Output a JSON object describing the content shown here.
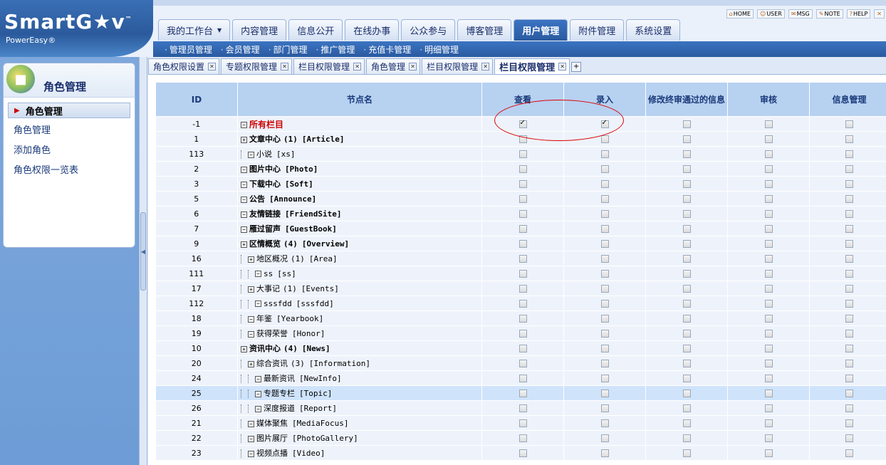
{
  "brand": {
    "logo": "SmartG★v",
    "tm": "™",
    "sub": "PowerEasy®"
  },
  "quicklinks": [
    {
      "icon": "home-icon",
      "label": "HOME"
    },
    {
      "icon": "user-icon",
      "label": "USER"
    },
    {
      "icon": "msg-icon",
      "label": "MSG"
    },
    {
      "icon": "note-icon",
      "label": "NOTE"
    },
    {
      "icon": "help-icon",
      "label": "HELP"
    },
    {
      "icon": "close-icon",
      "label": ""
    }
  ],
  "main_tabs": [
    {
      "label": "我的工作台",
      "dropdown": true
    },
    {
      "label": "内容管理"
    },
    {
      "label": "信息公开"
    },
    {
      "label": "在线办事"
    },
    {
      "label": "公众参与"
    },
    {
      "label": "博客管理"
    },
    {
      "label": "用户管理",
      "active": true
    },
    {
      "label": "附件管理"
    },
    {
      "label": "系统设置"
    }
  ],
  "sub_nav": [
    "管理员管理",
    "会员管理",
    "部门管理",
    "推广管理",
    "充值卡管理",
    "明细管理"
  ],
  "sidebar": {
    "title": "角色管理",
    "active": "角色管理",
    "items": [
      "角色管理",
      "添加角色",
      "角色权限一览表"
    ]
  },
  "doc_tabs": [
    {
      "label": "角色权限设置"
    },
    {
      "label": "专题权限管理"
    },
    {
      "label": "栏目权限管理"
    },
    {
      "label": "角色管理"
    },
    {
      "label": "栏目权限管理"
    },
    {
      "label": "栏目权限管理",
      "active": true
    }
  ],
  "table": {
    "headers": [
      "ID",
      "节点名",
      "查看",
      "录入",
      "修改终审通过的信息",
      "审核",
      "信息管理"
    ],
    "rows": [
      {
        "id": "-1",
        "name": "所有栏目",
        "code": "",
        "count": "",
        "level": 0,
        "toggle": "−",
        "red": true,
        "checks": [
          true,
          true,
          false,
          false,
          false
        ]
      },
      {
        "id": "1",
        "name": "文章中心",
        "count": "(1)",
        "code": "[Article]",
        "level": 0,
        "toggle": "+",
        "checks": [
          false,
          false,
          false,
          false,
          false
        ]
      },
      {
        "id": "113",
        "name": "小说",
        "count": "",
        "code": "[xs]",
        "level": 1,
        "toggle": "−",
        "checks": [
          false,
          false,
          false,
          false,
          false
        ]
      },
      {
        "id": "2",
        "name": "图片中心",
        "count": "",
        "code": "[Photo]",
        "level": 0,
        "toggle": "−",
        "checks": [
          false,
          false,
          false,
          false,
          false
        ]
      },
      {
        "id": "3",
        "name": "下载中心",
        "count": "",
        "code": "[Soft]",
        "level": 0,
        "toggle": "−",
        "checks": [
          false,
          false,
          false,
          false,
          false
        ]
      },
      {
        "id": "5",
        "name": "公告",
        "count": "",
        "code": "[Announce]",
        "level": 0,
        "toggle": "−",
        "checks": [
          false,
          false,
          false,
          false,
          false
        ]
      },
      {
        "id": "6",
        "name": "友情链接",
        "count": "",
        "code": "[FriendSite]",
        "level": 0,
        "toggle": "−",
        "checks": [
          false,
          false,
          false,
          false,
          false
        ]
      },
      {
        "id": "7",
        "name": "雁过留声",
        "count": "",
        "code": "[GuestBook]",
        "level": 0,
        "toggle": "−",
        "checks": [
          false,
          false,
          false,
          false,
          false
        ]
      },
      {
        "id": "9",
        "name": "区情概览",
        "count": "(4)",
        "code": "[Overview]",
        "level": 0,
        "toggle": "+",
        "checks": [
          false,
          false,
          false,
          false,
          false
        ]
      },
      {
        "id": "16",
        "name": "地区概况",
        "count": "(1)",
        "code": "[Area]",
        "level": 1,
        "toggle": "+",
        "checks": [
          false,
          false,
          false,
          false,
          false
        ]
      },
      {
        "id": "111",
        "name": "ss",
        "count": "",
        "code": "[ss]",
        "level": 2,
        "toggle": "−",
        "checks": [
          false,
          false,
          false,
          false,
          false
        ]
      },
      {
        "id": "17",
        "name": "大事记",
        "count": "(1)",
        "code": "[Events]",
        "level": 1,
        "toggle": "+",
        "checks": [
          false,
          false,
          false,
          false,
          false
        ]
      },
      {
        "id": "112",
        "name": "sssfdd",
        "count": "",
        "code": "[sssfdd]",
        "level": 2,
        "toggle": "−",
        "checks": [
          false,
          false,
          false,
          false,
          false
        ]
      },
      {
        "id": "18",
        "name": "年鉴",
        "count": "",
        "code": "[Yearbook]",
        "level": 1,
        "toggle": "−",
        "checks": [
          false,
          false,
          false,
          false,
          false
        ]
      },
      {
        "id": "19",
        "name": "获得荣誉",
        "count": "",
        "code": "[Honor]",
        "level": 1,
        "toggle": "−",
        "checks": [
          false,
          false,
          false,
          false,
          false
        ]
      },
      {
        "id": "10",
        "name": "资讯中心",
        "count": "(4)",
        "code": "[News]",
        "level": 0,
        "toggle": "+",
        "checks": [
          false,
          false,
          false,
          false,
          false
        ]
      },
      {
        "id": "20",
        "name": "综合资讯",
        "count": "(3)",
        "code": "[Information]",
        "level": 1,
        "toggle": "+",
        "checks": [
          false,
          false,
          false,
          false,
          false
        ]
      },
      {
        "id": "24",
        "name": "最新资讯",
        "count": "",
        "code": "[NewInfo]",
        "level": 2,
        "toggle": "−",
        "checks": [
          false,
          false,
          false,
          false,
          false
        ]
      },
      {
        "id": "25",
        "name": "专题专栏",
        "count": "",
        "code": "[Topic]",
        "level": 2,
        "toggle": "−",
        "highlight": true,
        "checks": [
          false,
          false,
          false,
          false,
          false
        ]
      },
      {
        "id": "26",
        "name": "深度报道",
        "count": "",
        "code": "[Report]",
        "level": 2,
        "toggle": "−",
        "checks": [
          false,
          false,
          false,
          false,
          false
        ]
      },
      {
        "id": "21",
        "name": "媒体聚焦",
        "count": "",
        "code": "[MediaFocus]",
        "level": 1,
        "toggle": "−",
        "checks": [
          false,
          false,
          false,
          false,
          false
        ]
      },
      {
        "id": "22",
        "name": "图片展厅",
        "count": "",
        "code": "[PhotoGallery]",
        "level": 1,
        "toggle": "−",
        "checks": [
          false,
          false,
          false,
          false,
          false
        ]
      },
      {
        "id": "23",
        "name": "视频点播",
        "count": "",
        "code": "[Video]",
        "level": 1,
        "toggle": "−",
        "checks": [
          false,
          false,
          false,
          false,
          false
        ]
      }
    ]
  }
}
